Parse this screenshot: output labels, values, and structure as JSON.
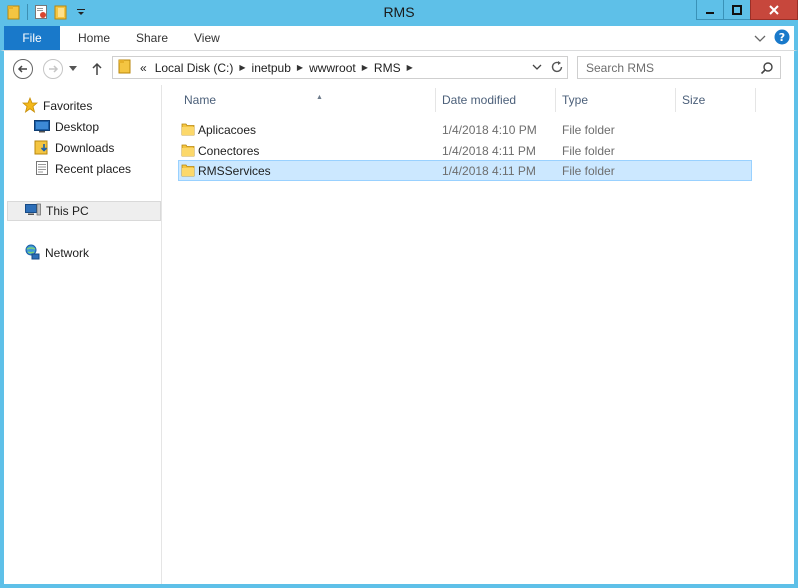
{
  "window": {
    "title": "RMS"
  },
  "ribbon": {
    "tabs": [
      {
        "label": "File"
      },
      {
        "label": "Home"
      },
      {
        "label": "Share"
      },
      {
        "label": "View"
      }
    ],
    "accent": "#1979ca"
  },
  "address": {
    "overflow": "«",
    "segments": [
      "Local Disk (C:)",
      "inetpub",
      "wwwroot",
      "RMS"
    ]
  },
  "search": {
    "placeholder": "Search RMS"
  },
  "nav": {
    "favorites_label": "Favorites",
    "favorites": [
      {
        "label": "Desktop",
        "icon": "desktop-icon"
      },
      {
        "label": "Downloads",
        "icon": "downloads-icon"
      },
      {
        "label": "Recent places",
        "icon": "recent-places-icon"
      }
    ],
    "this_pc_label": "This PC",
    "network_label": "Network"
  },
  "columns": {
    "name": "Name",
    "date_modified": "Date modified",
    "type": "Type",
    "size": "Size"
  },
  "files": [
    {
      "name": "Aplicacoes",
      "date_modified": "1/4/2018 4:10 PM",
      "type": "File folder",
      "size": ""
    },
    {
      "name": "Conectores",
      "date_modified": "1/4/2018 4:11 PM",
      "type": "File folder",
      "size": ""
    },
    {
      "name": "RMSServices",
      "date_modified": "1/4/2018 4:11 PM",
      "type": "File folder",
      "size": "",
      "selected": true
    }
  ],
  "colors": {
    "titlebar": "#5ec0e8",
    "selection": "#cce8ff",
    "close_button": "#c7473c"
  }
}
